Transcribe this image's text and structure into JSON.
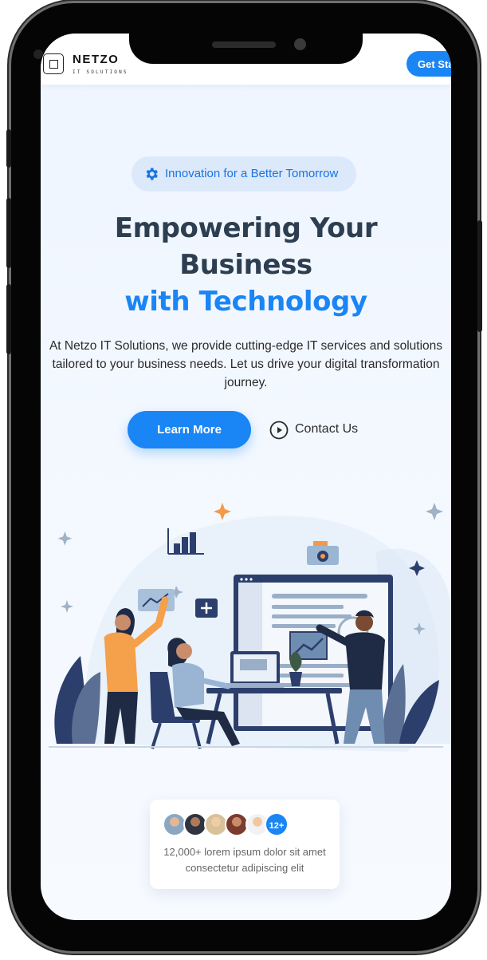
{
  "header": {
    "brand": "NETZO",
    "brand_sub": "IT SOLUTIONS",
    "cta_label": "Get Sta"
  },
  "hero": {
    "badge_icon": "gear-icon",
    "badge_text": "Innovation for a Better Tomorrow",
    "title_line1": "Empowering Your",
    "title_line2": "Business",
    "title_line3": "with Technology",
    "description": "At Netzo IT Solutions, we provide cutting-edge IT services and solutions tailored to your business needs. Let us drive your digital transformation journey.",
    "primary_button": "Learn More",
    "secondary_button": "Contact Us",
    "secondary_icon": "play-circle-icon"
  },
  "proof": {
    "more_count": "12+",
    "text": "12,000+ lorem ipsum dolor sit amet consectetur adipiscing elit"
  },
  "colors": {
    "accent": "#1a85f5",
    "heading": "#2c3e50",
    "badge_bg": "#dbe9fb"
  }
}
